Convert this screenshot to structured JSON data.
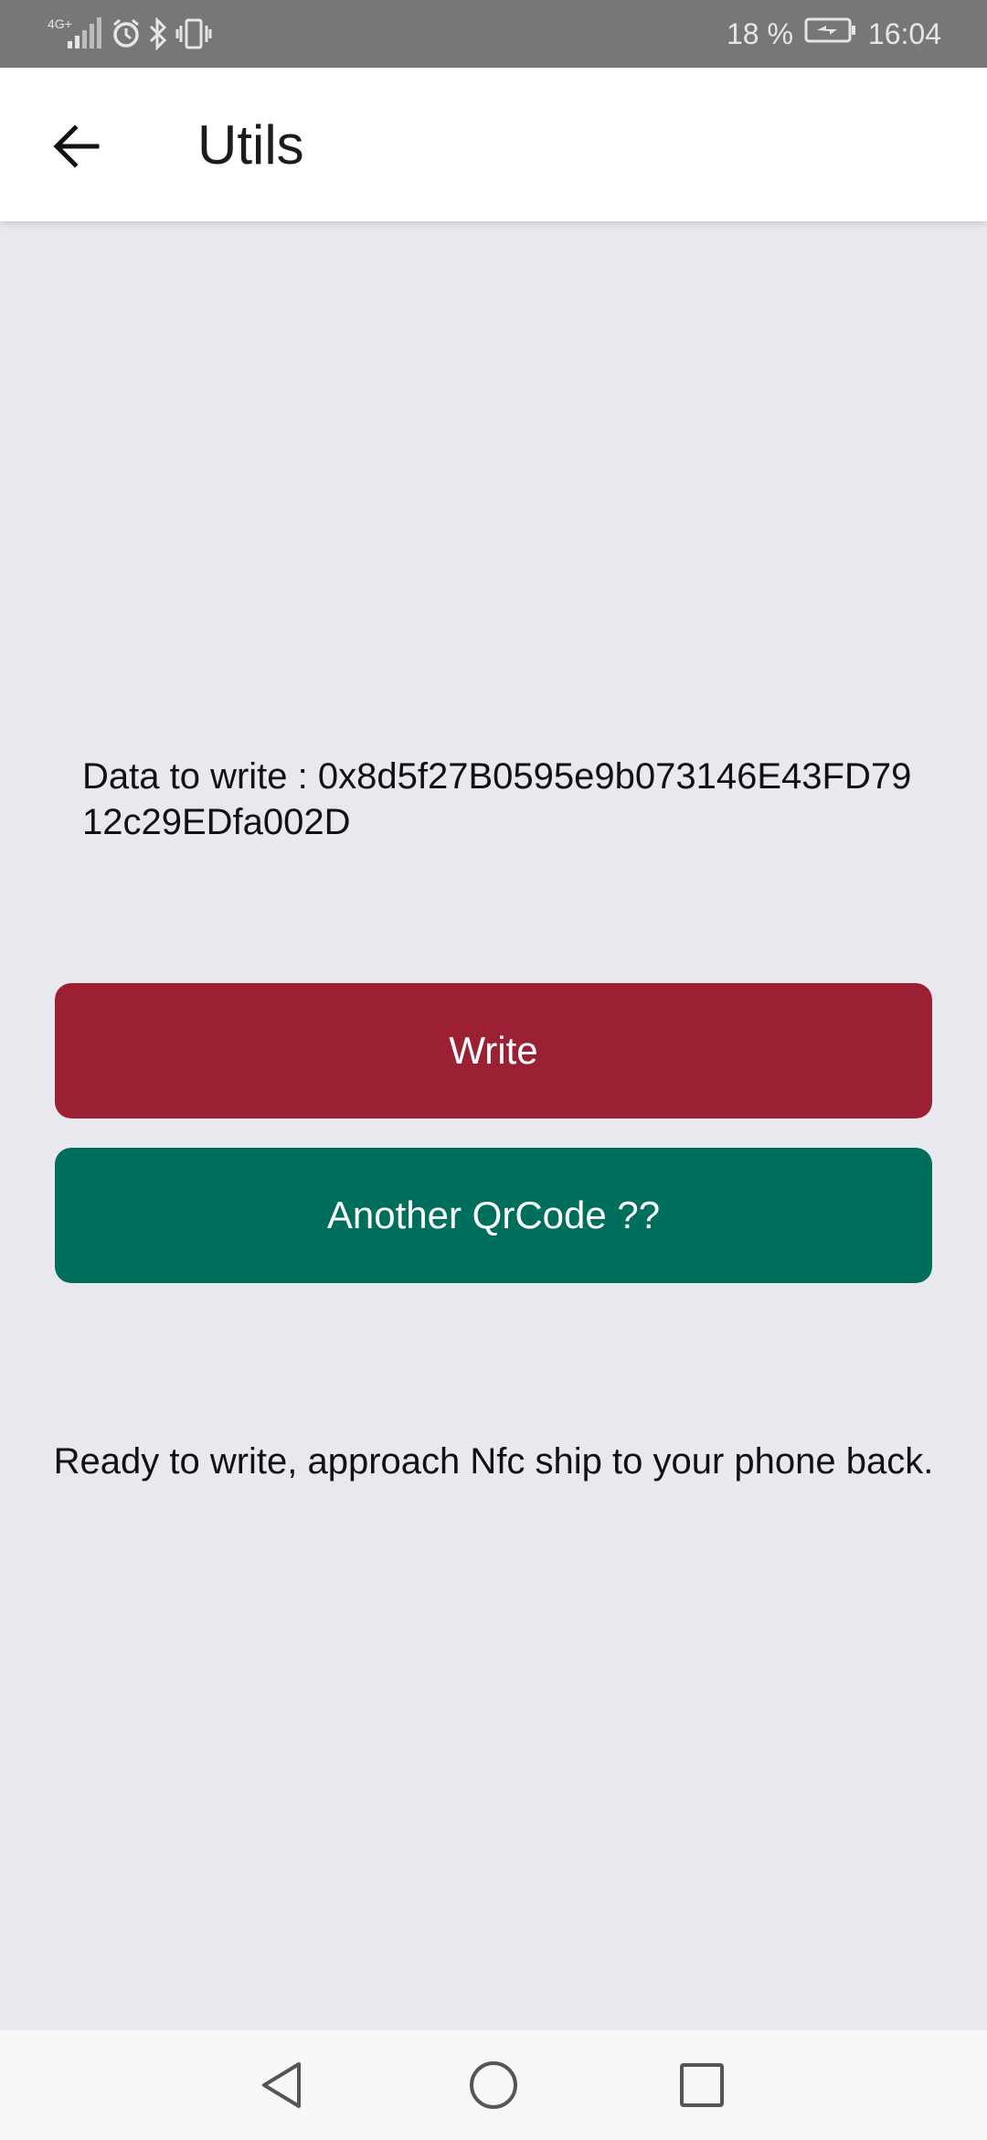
{
  "status_bar": {
    "network": "4G+",
    "battery_percent": "18 %",
    "time": "16:04",
    "icons": [
      "signal-icon",
      "alarm-icon",
      "bluetooth-icon",
      "vibrate-icon",
      "battery-charging-icon"
    ]
  },
  "app_bar": {
    "title": "Utils",
    "back_icon": "arrow-left-icon"
  },
  "main": {
    "data_to_write": "Data to write : 0x8d5f27B0595e9b073146E43FD7912c29EDfa002D",
    "write_button_label": "Write",
    "another_qrcode_button_label": "Another QrCode ??",
    "status_message": "Ready to write, approach Nfc ship to your phone back."
  },
  "nav_bar": {
    "icons": [
      "back-triangle-icon",
      "home-circle-icon",
      "recents-square-icon"
    ]
  },
  "colors": {
    "status_bar": "#777777",
    "background": "#e9e8ee",
    "write_button": "#9c2034",
    "qrcode_button": "#006e5c"
  }
}
